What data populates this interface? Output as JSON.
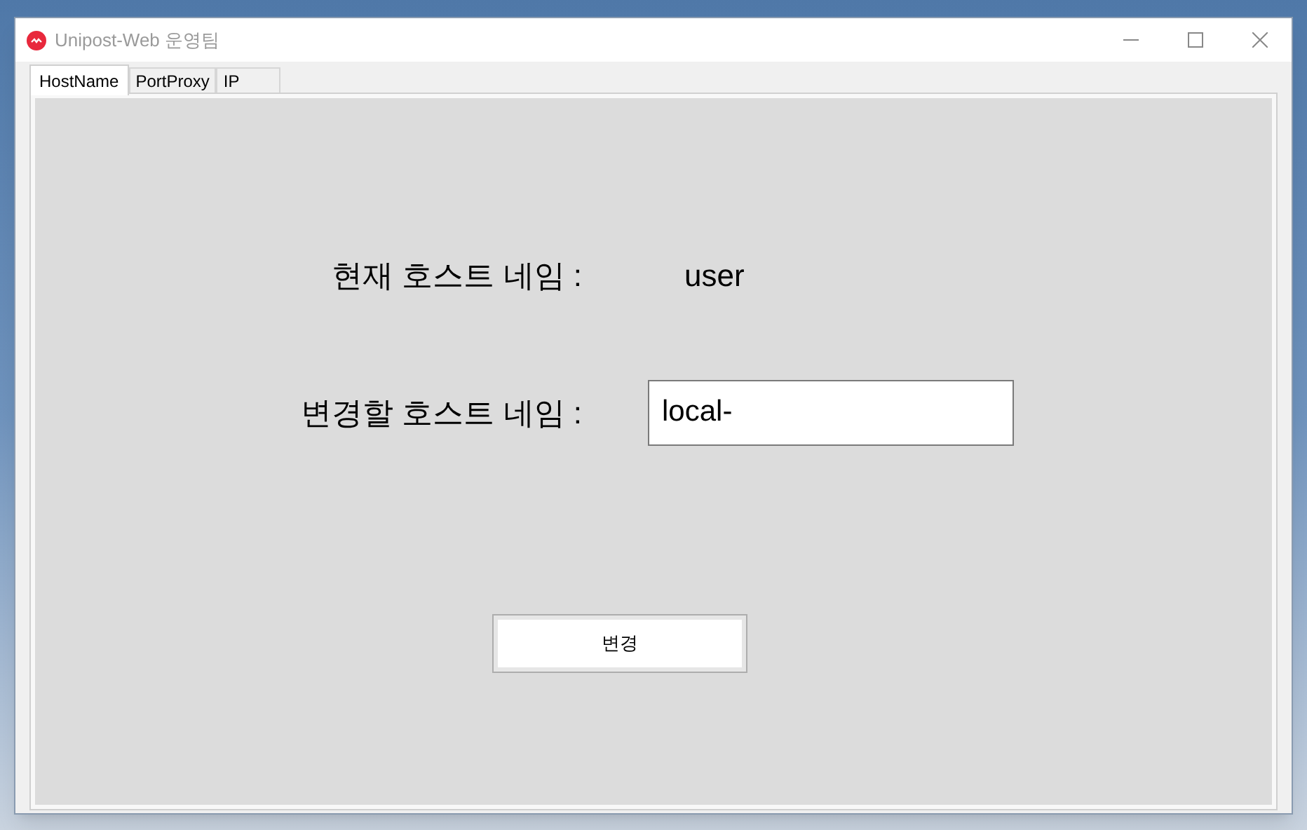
{
  "window": {
    "title": "Unipost-Web 운영팀"
  },
  "tabs": [
    {
      "label": "HostName",
      "selected": true
    },
    {
      "label": "PortProxy",
      "selected": false
    },
    {
      "label": "IP",
      "selected": false
    }
  ],
  "current_hostname": {
    "label": "현재 호스트 네임 :",
    "value": "user"
  },
  "new_hostname": {
    "label": "변경할 호스트 네임 :",
    "value": "local-"
  },
  "buttons": [
    "변경"
  ]
}
